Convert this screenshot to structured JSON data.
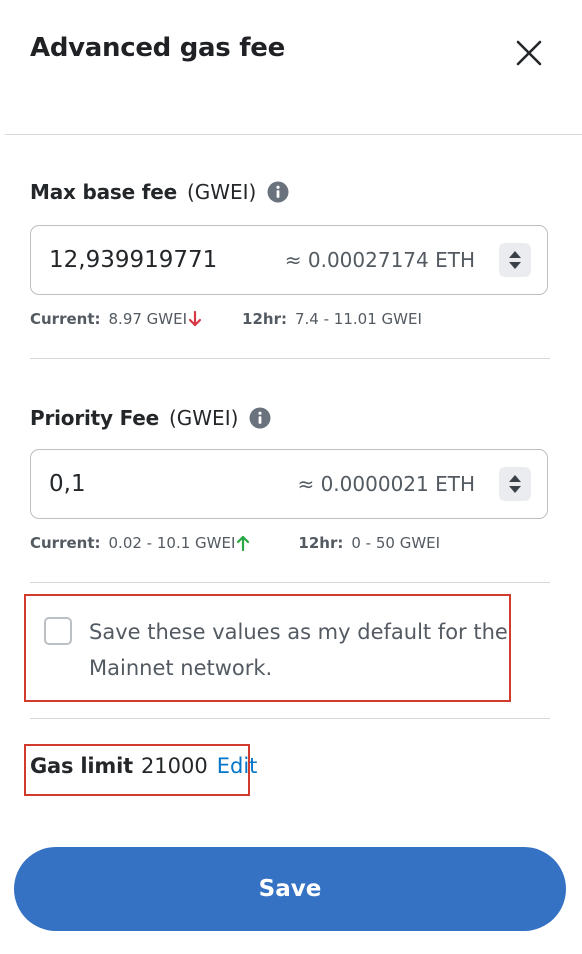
{
  "header": {
    "title": "Advanced gas fee"
  },
  "max_base_fee": {
    "label": "Max base fee",
    "unit": "(GWEI)",
    "value": "12,939919771",
    "eth_estimate": "≈ 0.00027174 ETH",
    "current_label": "Current:",
    "current_value": "8.97 GWEI",
    "current_trend": "down",
    "range_label": "12hr:",
    "range_value": "7.4 - 11.01 GWEI"
  },
  "priority_fee": {
    "label": "Priority Fee",
    "unit": "(GWEI)",
    "value": "0,1",
    "eth_estimate": "≈ 0.0000021 ETH",
    "current_label": "Current:",
    "current_value": "0.02 - 10.1 GWEI",
    "current_trend": "up",
    "range_label": "12hr:",
    "range_value": "0 - 50 GWEI"
  },
  "save_default": {
    "checked": false,
    "label": "Save these values as my default for the Mainnet network."
  },
  "gas_limit": {
    "label": "Gas limit",
    "value": "21000",
    "edit_label": "Edit"
  },
  "footer": {
    "save_label": "Save"
  },
  "colors": {
    "primary": "#3572c4",
    "link": "#0376c9",
    "trend_down": "#d73847",
    "trend_up": "#28a745",
    "highlight": "#d23a2c"
  },
  "icons": {
    "close": "close-icon",
    "info": "info-icon",
    "stepper": "stepper-icon",
    "trend_down": "arrow-down-icon",
    "trend_up": "arrow-up-icon"
  }
}
